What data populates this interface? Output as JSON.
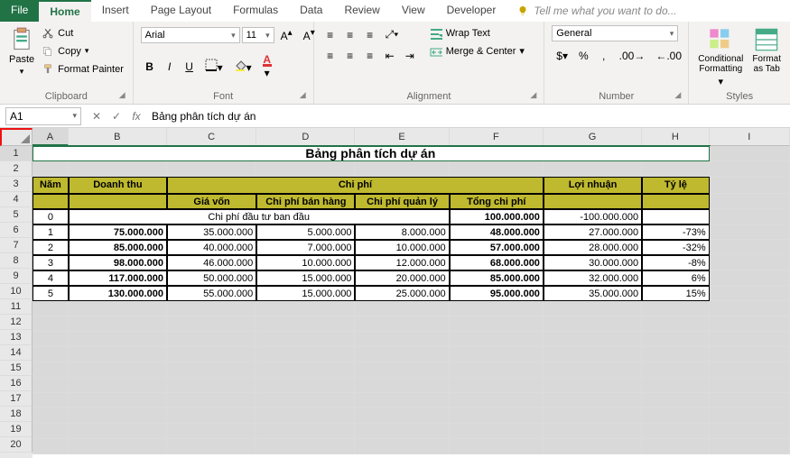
{
  "tabs": [
    "File",
    "Home",
    "Insert",
    "Page Layout",
    "Formulas",
    "Data",
    "Review",
    "View",
    "Developer"
  ],
  "tell_me": "Tell me what you want to do...",
  "ribbon": {
    "clipboard": {
      "paste": "Paste",
      "cut": "Cut",
      "copy": "Copy",
      "fmt": "Format Painter",
      "label": "Clipboard"
    },
    "font": {
      "name": "Arial",
      "size": "11",
      "label": "Font",
      "bold": "B",
      "italic": "I",
      "underline": "U"
    },
    "alignment": {
      "wrap": "Wrap Text",
      "merge": "Merge & Center",
      "label": "Alignment"
    },
    "number": {
      "format": "General",
      "label": "Number"
    },
    "styles": {
      "cond": "Conditional Formatting",
      "fmttab": "Format as Tab",
      "label": "Styles"
    }
  },
  "active_cell": "A1",
  "formula": "Bảng phân tích dự án",
  "columns": [
    "A",
    "B",
    "C",
    "D",
    "E",
    "F",
    "G",
    "H",
    "I"
  ],
  "rows": [
    1,
    2,
    3,
    4,
    5,
    6,
    7,
    8,
    9,
    10,
    11,
    12,
    13,
    14,
    15,
    16,
    17,
    18,
    19,
    20
  ],
  "table": {
    "title": "Bảng phân tích dự án",
    "headers": {
      "nam": "Năm",
      "doanhthu": "Doanh thu",
      "chiphi": "Chi phí",
      "gia_von": "Giá vốn",
      "cp_banhang": "Chi phí bán hàng",
      "cp_quanly": "Chi phí quản lý",
      "tong_cp": "Tổng chi phí",
      "loinuan": "Lợi nhuận",
      "tyle": "Tỷ lệ"
    },
    "initial_label": "Chi phí đầu tư ban đầu",
    "data": [
      {
        "nam": "0",
        "dt": "",
        "gv": "",
        "bh": "",
        "ql": "",
        "tcp": "100.000.000",
        "ln": "-100.000.000",
        "tl": ""
      },
      {
        "nam": "1",
        "dt": "75.000.000",
        "gv": "35.000.000",
        "bh": "5.000.000",
        "ql": "8.000.000",
        "tcp": "48.000.000",
        "ln": "27.000.000",
        "tl": "-73%"
      },
      {
        "nam": "2",
        "dt": "85.000.000",
        "gv": "40.000.000",
        "bh": "7.000.000",
        "ql": "10.000.000",
        "tcp": "57.000.000",
        "ln": "28.000.000",
        "tl": "-32%"
      },
      {
        "nam": "3",
        "dt": "98.000.000",
        "gv": "46.000.000",
        "bh": "10.000.000",
        "ql": "12.000.000",
        "tcp": "68.000.000",
        "ln": "30.000.000",
        "tl": "-8%"
      },
      {
        "nam": "4",
        "dt": "117.000.000",
        "gv": "50.000.000",
        "bh": "15.000.000",
        "ql": "20.000.000",
        "tcp": "85.000.000",
        "ln": "32.000.000",
        "tl": "6%"
      },
      {
        "nam": "5",
        "dt": "130.000.000",
        "gv": "55.000.000",
        "bh": "15.000.000",
        "ql": "25.000.000",
        "tcp": "95.000.000",
        "ln": "35.000.000",
        "tl": "15%"
      }
    ]
  }
}
